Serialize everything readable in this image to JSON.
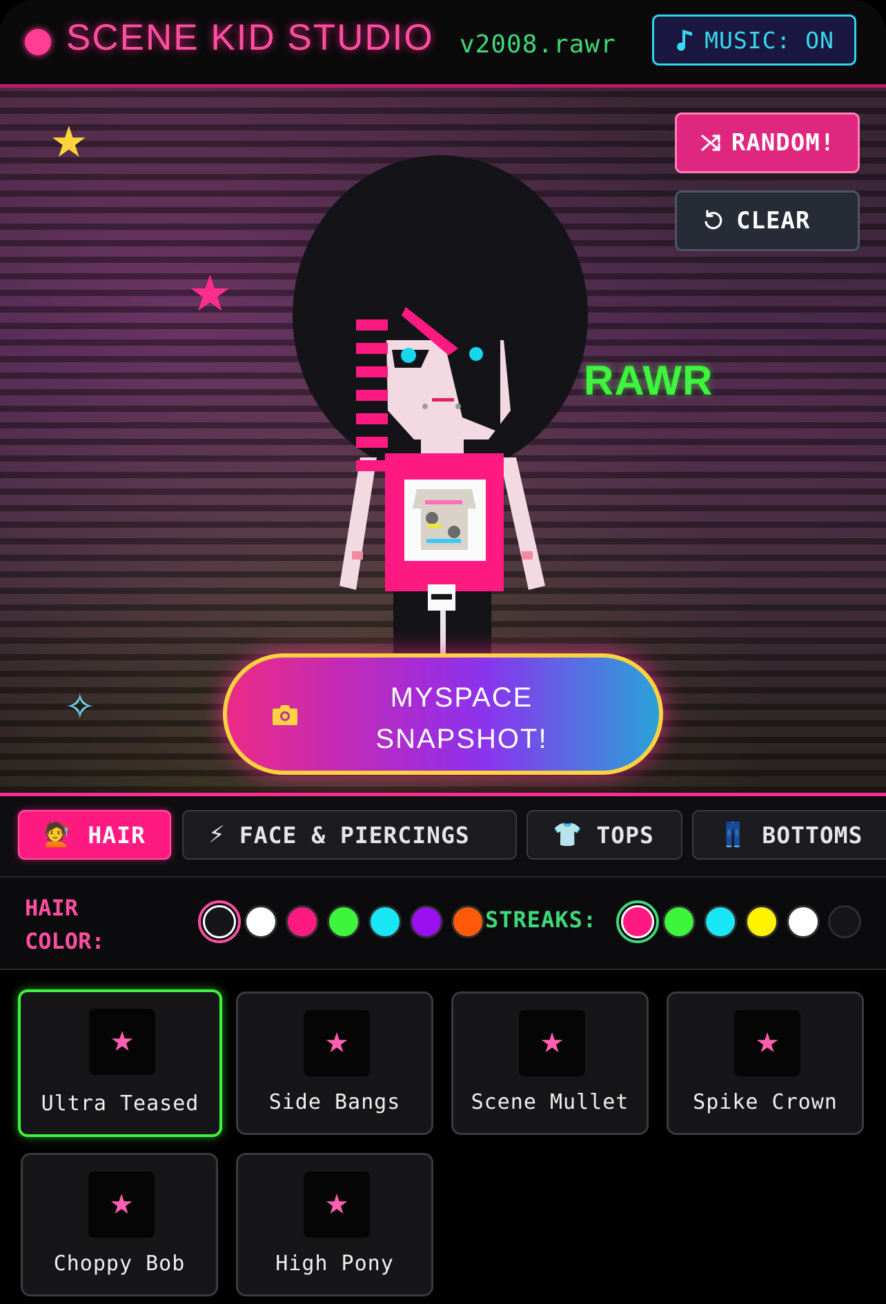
{
  "header": {
    "title": "SCENE KID STUDIO",
    "version": "v2008.rawr",
    "music_button": "MUSIC: ON"
  },
  "stage": {
    "random_button": "RANDOM!",
    "clear_button": "CLEAR",
    "rawr_text": "RAWR",
    "snapshot_button_line1": "MYSPACE",
    "snapshot_button_line2": "SNAPSHOT!"
  },
  "tabs": [
    {
      "icon": "💇",
      "label": "HAIR",
      "active": true
    },
    {
      "icon": "⚡",
      "label": "FACE & PIERCINGS",
      "active": false
    },
    {
      "icon": "👕",
      "label": "TOPS",
      "active": false
    },
    {
      "icon": "👖",
      "label": "BOTTOMS",
      "active": false
    }
  ],
  "hair_color": {
    "label": "HAIR COLOR:",
    "swatches": [
      "#15151a",
      "#ffffff",
      "#ff1a82",
      "#3cf53c",
      "#19e6f5",
      "#9b10f0",
      "#ff5a0a"
    ],
    "selected_index": 0
  },
  "streaks": {
    "label": "STREAKS:",
    "swatches": [
      "#ff1a82",
      "#3cf53c",
      "#19e6f5",
      "#fff200",
      "#ffffff",
      "#15151a"
    ],
    "selected_index": 0
  },
  "styles": [
    {
      "name": "Ultra Teased",
      "selected": true
    },
    {
      "name": "Side Bangs",
      "selected": false
    },
    {
      "name": "Scene Mullet",
      "selected": false
    },
    {
      "name": "Spike Crown",
      "selected": false
    },
    {
      "name": "Choppy Bob",
      "selected": false
    },
    {
      "name": "High Pony",
      "selected": false
    }
  ],
  "colors": {
    "accent_pink": "#ff1a82",
    "accent_green": "#3cf53c",
    "accent_cyan": "#2fd6ee",
    "accent_yellow": "#ffd23f"
  }
}
